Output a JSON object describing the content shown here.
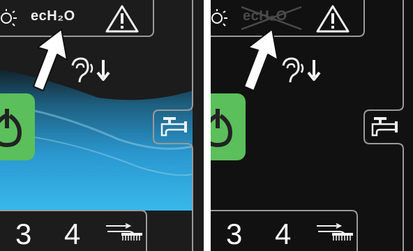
{
  "panels": [
    {
      "id": "left",
      "state": "normal",
      "ech2o_label": "ecH₂O",
      "icons": [
        "bulb-icon",
        "warning-icon",
        "ear-volume-down-icon",
        "power-icon",
        "faucet-icon",
        "brush-icon",
        "arrow-icon"
      ],
      "numbers": [
        "3",
        "4"
      ]
    },
    {
      "id": "right",
      "state": "ech2o-disabled",
      "ech2o_label": "ecH₂O",
      "icons": [
        "bulb-icon",
        "warning-icon",
        "ear-volume-down-icon",
        "power-icon",
        "faucet-icon",
        "brush-icon",
        "arrow-icon"
      ],
      "numbers": [
        "3",
        "4"
      ]
    }
  ],
  "colors": {
    "panel_bg": "#1a1a1a",
    "border": "#9a9a9a",
    "power_green": "#5bbf5b",
    "water_blue": "#2aa8dc",
    "dim_text": "#4a4a4a"
  }
}
